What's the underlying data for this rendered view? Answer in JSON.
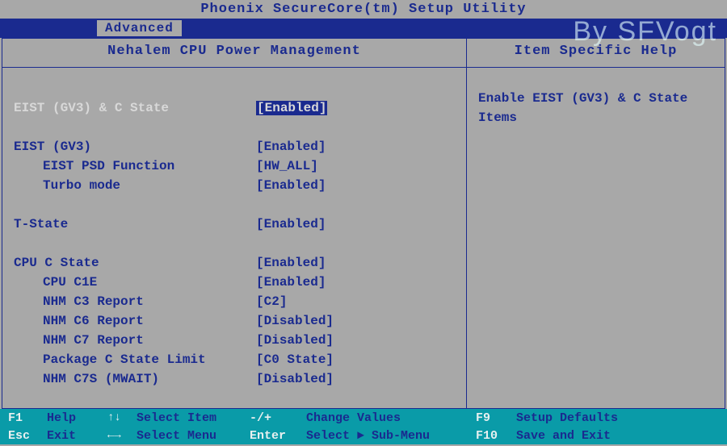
{
  "title": "Phoenix SecureCore(tm) Setup Utility",
  "tab": "Advanced",
  "watermark": "By SFVogt",
  "main_header": "Nehalem CPU Power Management",
  "help_header": "Item Specific Help",
  "help_text": "Enable EIST (GV3) & C State Items",
  "settings": {
    "eist_cstate": {
      "label": "EIST (GV3) & C State",
      "value": "Enabled"
    },
    "eist_gv3": {
      "label": "EIST (GV3)",
      "value": "Enabled"
    },
    "eist_psd": {
      "label": "EIST PSD Function",
      "value": "HW_ALL"
    },
    "turbo": {
      "label": "Turbo mode",
      "value": "Enabled"
    },
    "tstate": {
      "label": "T-State",
      "value": "Enabled"
    },
    "cpu_cstate": {
      "label": "CPU C State",
      "value": "Enabled"
    },
    "cpu_c1e": {
      "label": "CPU C1E",
      "value": "Enabled"
    },
    "nhm_c3": {
      "label": "NHM C3 Report",
      "value": "C2"
    },
    "nhm_c6": {
      "label": "NHM C6 Report",
      "value": "Disabled"
    },
    "nhm_c7": {
      "label": "NHM C7 Report",
      "value": "Disabled"
    },
    "pkg_climit": {
      "label": "Package C State Limit",
      "value": "C0 State"
    },
    "nhm_c7s": {
      "label": "NHM C7S (MWAIT)",
      "value": "Disabled"
    }
  },
  "footer": {
    "r1": {
      "k1": "F1",
      "a1": "Help",
      "arr": "↑↓",
      "a2": "Select Item",
      "k2": "-/+",
      "a3": "Change Values",
      "k3": "F9",
      "a4": "Setup Defaults"
    },
    "r2": {
      "k1": "Esc",
      "a1": "Exit",
      "arr": "←→",
      "a2": "Select Menu",
      "k2": "Enter",
      "a3": "Select ► Sub-Menu",
      "k3": "F10",
      "a4": "Save and Exit"
    }
  }
}
